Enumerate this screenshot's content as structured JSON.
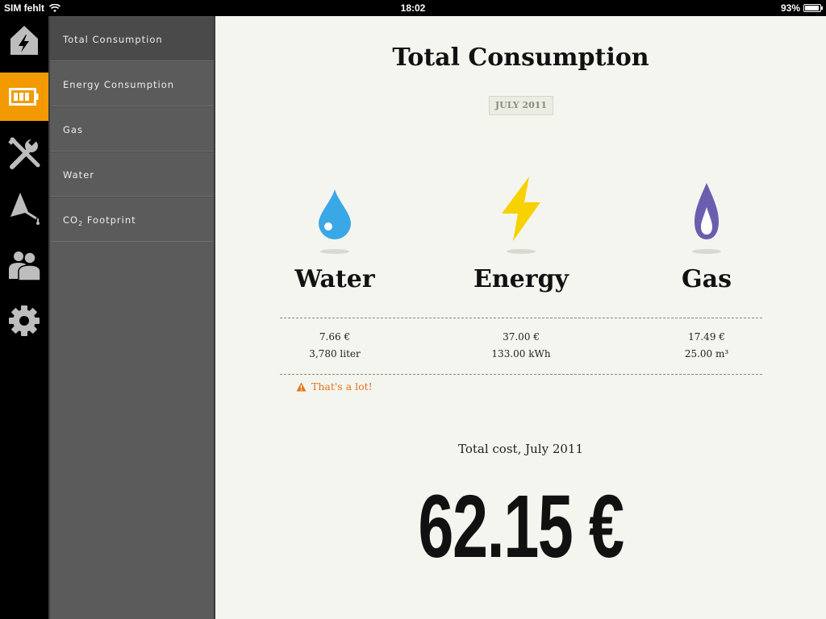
{
  "status_bar": {
    "carrier": "SIM fehlt",
    "time": "18:02",
    "battery": "93%",
    "battery_level": 0.93
  },
  "rail": {
    "items": [
      {
        "icon": "home-lightning-icon",
        "active": false
      },
      {
        "icon": "battery-icon",
        "active": true
      },
      {
        "icon": "tools-icon",
        "active": false
      },
      {
        "icon": "lamp-icon",
        "active": false
      },
      {
        "icon": "users-icon",
        "active": false
      },
      {
        "icon": "gear-icon",
        "active": false
      }
    ],
    "accent_color": "#f29a00"
  },
  "menu": {
    "items": [
      {
        "label": "Total Consumption",
        "active": true
      },
      {
        "label": "Energy Consumption",
        "active": false
      },
      {
        "label": "Gas",
        "active": false
      },
      {
        "label": "Water",
        "active": false
      },
      {
        "label": "CO",
        "sub": "2",
        "suffix": " Footprint",
        "active": false
      }
    ]
  },
  "main": {
    "title": "Total Consumption",
    "date_badge": "JULY 2011",
    "columns": [
      {
        "title": "Water",
        "icon": "water-drop-icon",
        "color": "#3aa7e6",
        "cost": "7.66 €",
        "amount": "3,780 liter"
      },
      {
        "title": "Energy",
        "icon": "lightning-icon",
        "color": "#f7d100",
        "cost": "37.00 €",
        "amount": "133.00 kWh"
      },
      {
        "title": "Gas",
        "icon": "gas-flame-icon",
        "color": "#6a5fae",
        "cost": "17.49 €",
        "amount": "25.00 m³"
      }
    ],
    "warning": "That's a lot!",
    "warning_color": "#e5731a",
    "total_label": "Total cost, July 2011",
    "total_value": "62.15 €"
  }
}
